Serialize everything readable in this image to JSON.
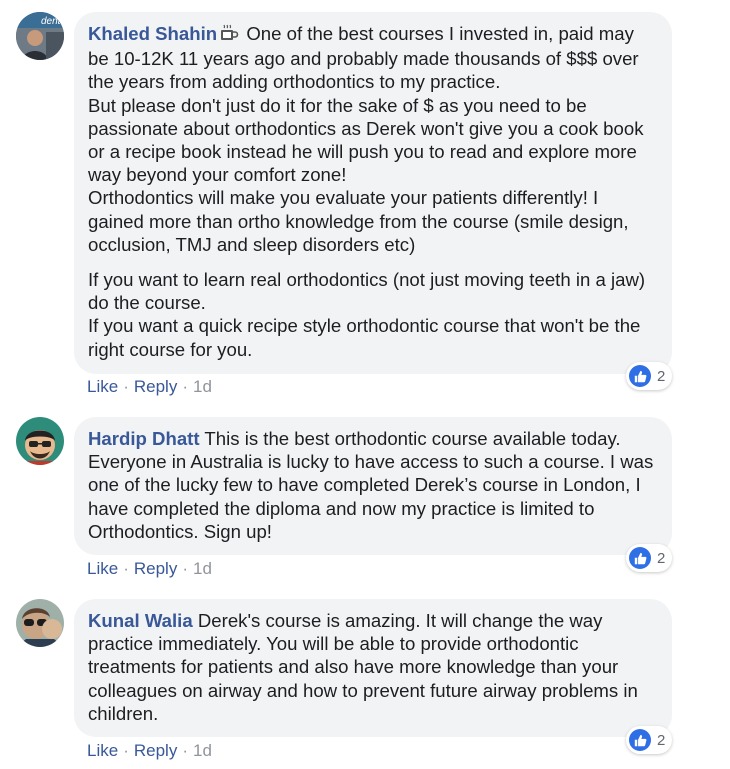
{
  "comments": [
    {
      "author": "Khaled Shahin",
      "avatar_text": "denta",
      "paragraphs": [
        "One of the best courses I invested in, paid may be 10-12K 11 years ago and probably made thousands of $$$ over the years from adding orthodontics to my practice.\nBut please don't just do it for the sake of $ as you need to be passionate about orthodontics as Derek won't give you a cook book or a recipe book instead he will push you to read and explore more way beyond your comfort zone!\nOrthodontics will make you evaluate your patients differently! I gained more than ortho knowledge from the course (smile design, occlusion, TMJ and sleep disorders etc)",
        "If you want to learn real orthodontics (not just moving teeth in a jaw) do the course.\nIf you want a quick recipe style orthodontic course that won't be the right course for you."
      ],
      "like_label": "Like",
      "reply_label": "Reply",
      "separator": "·",
      "time": "1d",
      "reaction_count": "2"
    },
    {
      "author": "Hardip Dhatt",
      "paragraphs": [
        "This is the best orthodontic course available today. Everyone in Australia is lucky to have access to such a course. I was one of the lucky few to have completed Derek’s course in London, I have completed the diploma and now my practice is limited to Orthodontics. Sign up!"
      ],
      "like_label": "Like",
      "reply_label": "Reply",
      "separator": "·",
      "time": "1d",
      "reaction_count": "2"
    },
    {
      "author": "Kunal Walia",
      "paragraphs": [
        "Derek's course is amazing. It will change the way practice immediately. You will be able to provide orthodontic treatments for patients and also have more knowledge than your colleagues on airway and how to prevent future airway problems in children."
      ],
      "like_label": "Like",
      "reply_label": "Reply",
      "separator": "·",
      "time": "1d",
      "reaction_count": "2"
    }
  ],
  "colors": {
    "author": "#385898",
    "bubble": "#f2f3f5",
    "like_badge": "#2f6fe6",
    "meta": "#90949c"
  }
}
